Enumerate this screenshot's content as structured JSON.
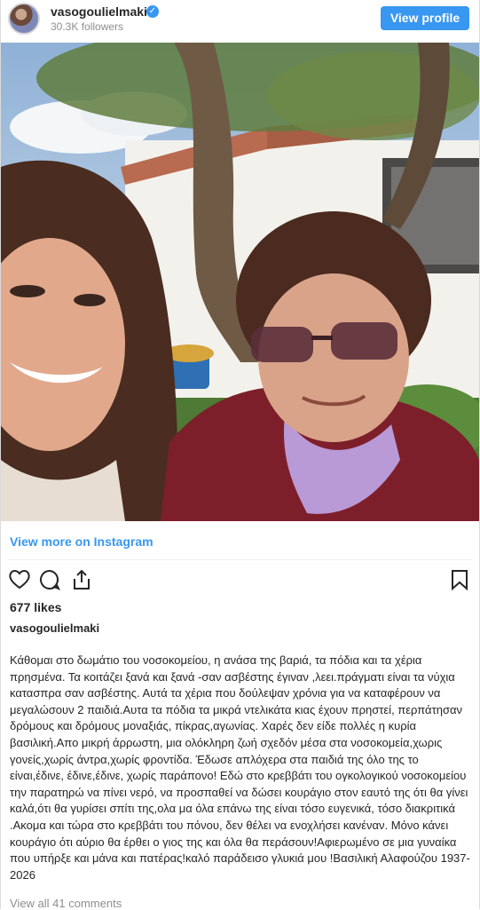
{
  "header": {
    "username": "vasogoulielmaki",
    "verified_icon": "verified-badge-icon",
    "followers": "30.3K followers",
    "view_profile_label": "View profile"
  },
  "post": {
    "view_more_label": "View more on Instagram",
    "likes": "677 likes",
    "owner": "vasogoulielmaki",
    "caption": "Κάθομαι στο δωμάτιο του νοσοκομείου, η ανάσα της βαριά, τα πόδια και τα χέρια πρησμένα. Τα κοιτάζει ξανά και ξανά -σαν ασβέστης έγιναν ,λεει.πράγματι είναι τα νύχια κατασπρα σαν ασβέστης. Αυτά τα χέρια που δούλεψαν χρόνια για να καταφέρουν να μεγαλώσουν 2 παιδιά.Αυτα τα πόδια τα μικρά ντελικάτα κιας έχουν πρηστεί, περπάτησαν δρόμους και δρόμους μοναξιάς, πίκρας,αγωνίας. Χαρές δεν είδε πολλές η κυρία βασιλική.Απο μικρή άρρωστη, μια ολόκληρη ζωή σχεδόν μέσα στα νοσοκομεία,χωρις γονείς,χωρίς άντρα,χωρίς φροντίδα. Έδωσε απλόχερα στα παιδιά της όλο της το είναι,έδινε, έδινε,έδινε, χωρίς παράπονο! Εδώ στο κρεββάτι του ογκολογικού νοσοκομείου την παρατηρώ να πίνει νερό, να προσπαθεί να δώσει κουράγιο στον εαυτό της ότι θα γίνει καλά,ότι θα γυρίσει σπίτι της,ολα μα όλα επάνω της είναι τόσο ευγενικά, τόσο διακριτικά .Ακομα και τώρα στο κρεββάτι του πόνου, δεν θέλει να ενοχλήσει κανέναν. Μόνο κάνει κουράγιο ότι αύριο θα έρθει ο γιος της και όλα θα περάσουν!Αφιερωμένο σε μια γυναίκα που υπήρξε και μάνα και πατέρας!καλό παράδεισο γλυκιά μου !Βασιλική Αλαφούζου 1937-2026",
    "comments_label": "View all 41 comments"
  },
  "colors": {
    "accent": "#3897f0",
    "text": "#262626",
    "muted": "#8e8e8e"
  },
  "icons": [
    "heart-icon",
    "comment-icon",
    "share-icon",
    "bookmark-icon"
  ]
}
